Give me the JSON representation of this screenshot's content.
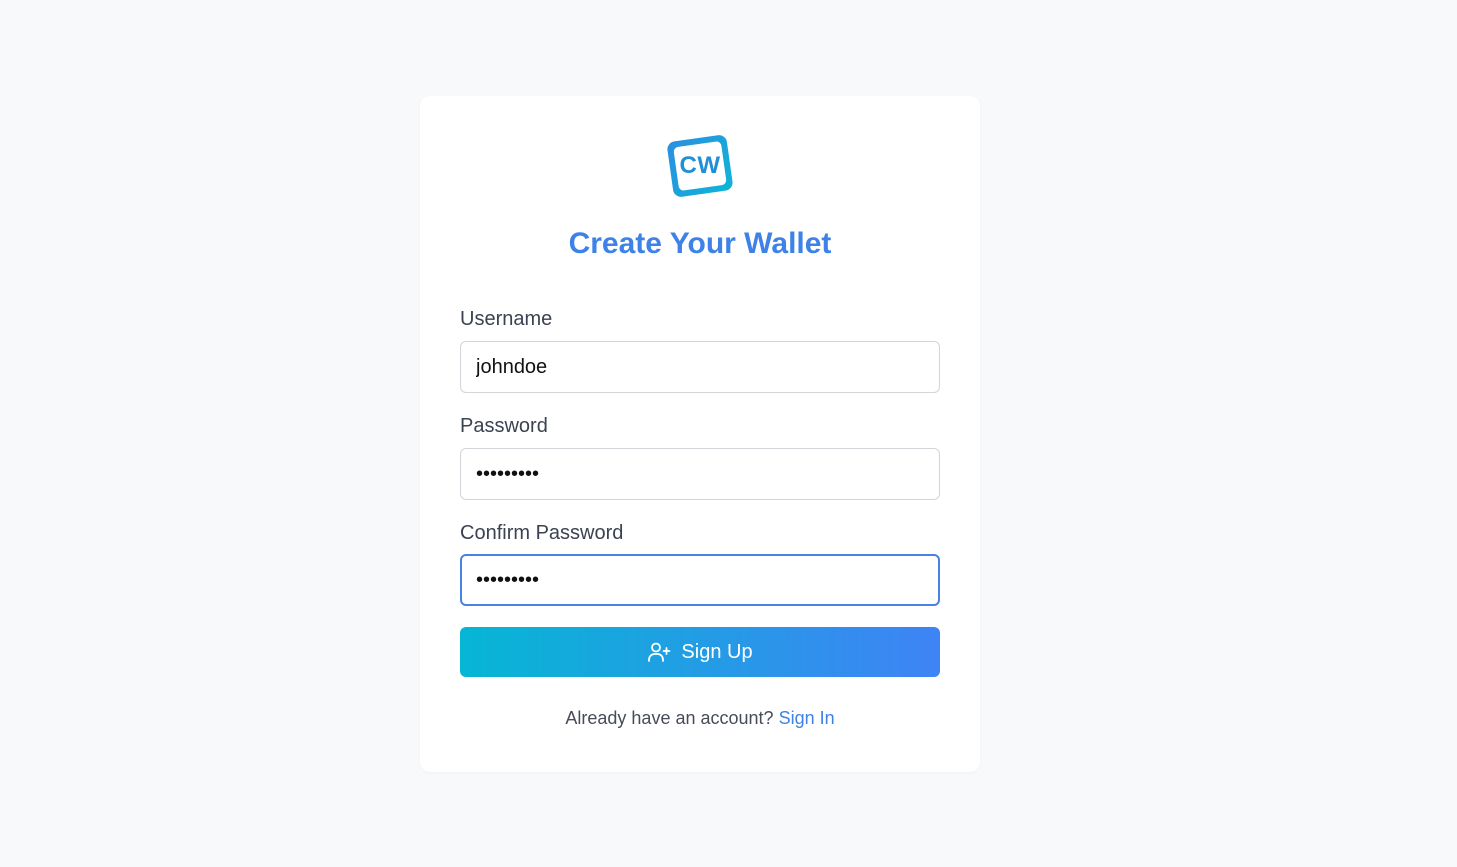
{
  "brand": {
    "logo_text": "CW",
    "accent_color": "#3e82e8",
    "gradient_start": "#06b6d4",
    "gradient_end": "#3f83f5"
  },
  "form": {
    "title": "Create Your Wallet",
    "username": {
      "label": "Username",
      "value": "johndoe"
    },
    "password": {
      "label": "Password",
      "value": "•••••••••"
    },
    "confirm_password": {
      "label": "Confirm Password",
      "value": "•••••••••"
    },
    "submit": {
      "label": "Sign Up",
      "icon": "user-plus-icon"
    }
  },
  "footer": {
    "prompt": "Already have an account?",
    "link_label": "Sign In"
  }
}
